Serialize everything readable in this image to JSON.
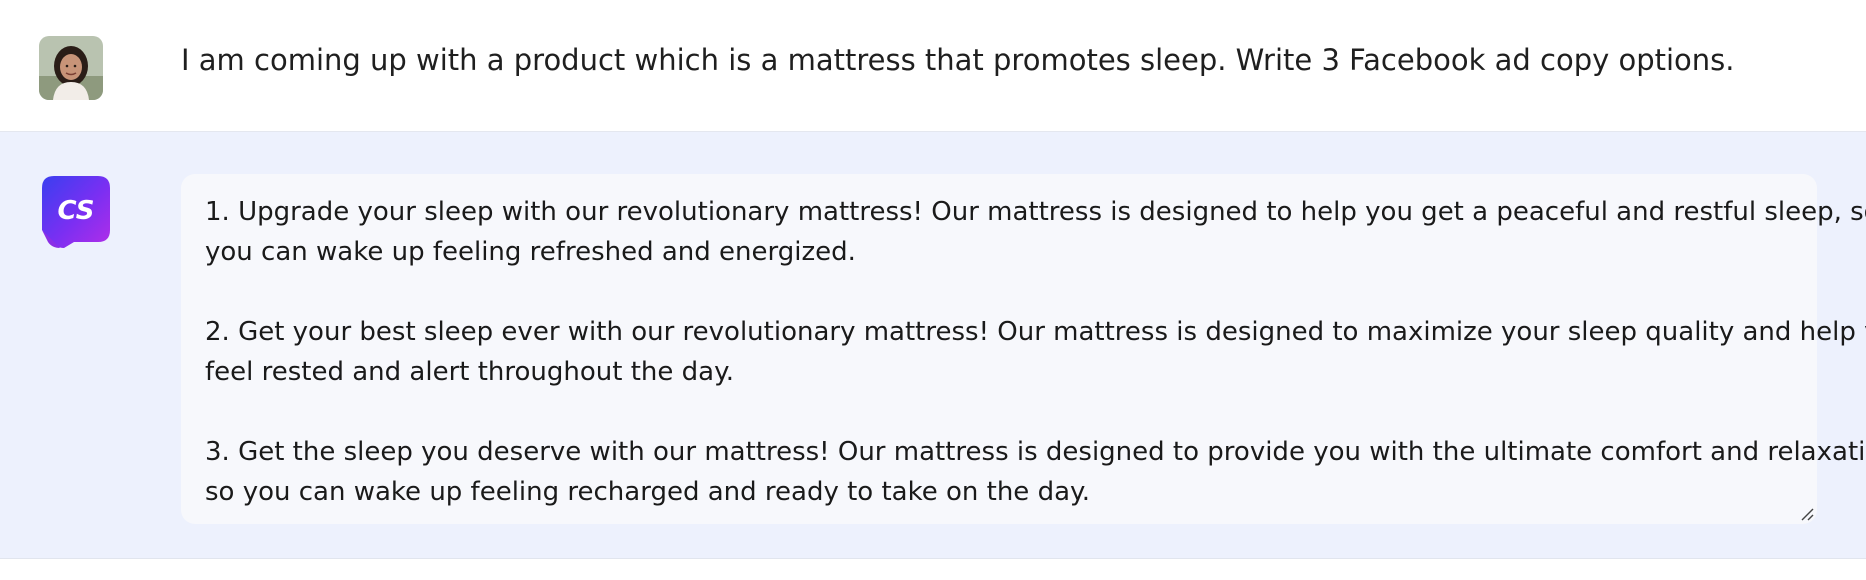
{
  "user_message": {
    "text": "I am coming up with a product which is a mattress that promotes sleep. Write 3 Facebook ad copy options."
  },
  "assistant": {
    "logo_text": "CS",
    "logo_color_start": "#7b2ff2",
    "logo_color_end": "#2b4ff5",
    "paragraphs": [
      {
        "line1": "1. Upgrade your sleep with our revolutionary mattress! Our mattress is designed to help you get a peaceful and restful sleep, so",
        "line2": "you can wake up feeling refreshed and energized."
      },
      {
        "line1": "2. Get your best sleep ever with our revolutionary mattress! Our mattress is designed to maximize your sleep quality and help you",
        "line2": "feel rested and alert throughout the day."
      },
      {
        "line1": "3. Get the sleep you deserve with our mattress! Our mattress is designed to provide you with the ultimate comfort and relaxation,",
        "line2": "so you can wake up feeling recharged and ready to take on the day."
      }
    ]
  },
  "colors": {
    "assistant_bg": "#edf1fd",
    "response_box_bg": "#f7f8fc",
    "text": "#1a1a1a"
  },
  "icons": {
    "user_avatar": "user-avatar-photo",
    "bot_logo": "copysmith-cs-logo",
    "resize": "resize-grip-icon"
  }
}
